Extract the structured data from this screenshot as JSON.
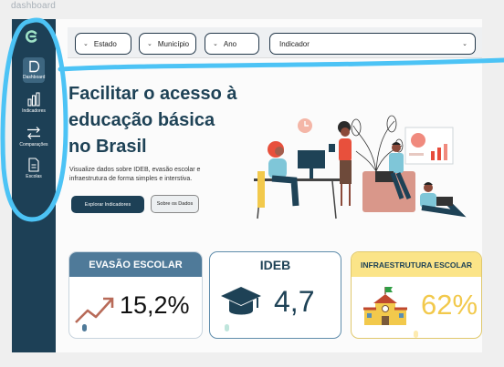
{
  "window": {
    "label": "dashboard"
  },
  "sidebar": {
    "items": [
      {
        "label": "Dashboard",
        "icon": "document-icon",
        "active": true
      },
      {
        "label": "Indicadores",
        "icon": "bar-chart-icon"
      },
      {
        "label": "Comparações",
        "icon": "swap-arrows-icon"
      },
      {
        "label": "Escolas",
        "icon": "file-list-icon"
      }
    ]
  },
  "filters": {
    "estado": "Estado",
    "municipio": "Município",
    "ano": "Ano",
    "indicador": "Indicador"
  },
  "hero": {
    "line1": "Facilitar o acesso à",
    "line2": "educação básica",
    "line3": "no Brasil",
    "subtitle": "Visualize dados sobre IDEB, evasão escolar e infraestrutura de forma simples e interstiva.",
    "primary_button": "Explorar Indicadores",
    "secondary_button": "Sobre os Dados"
  },
  "cards": [
    {
      "title": "EVASÃO ESCOLAR",
      "value": "15,2%",
      "icon": "trend-up-icon",
      "color": "#4f7a99"
    },
    {
      "title": "IDEB",
      "value": "4,7",
      "icon": "graduation-cap-icon",
      "color": "#1e4256"
    },
    {
      "title": "INFRAESTRUTURA ESCOLAR",
      "value": "62%",
      "icon": "school-building-icon",
      "color": "#f2c94c"
    }
  ],
  "colors": {
    "sidebar": "#1d4056",
    "accent": "#3d6680",
    "highlight": "#4cc3f5"
  }
}
